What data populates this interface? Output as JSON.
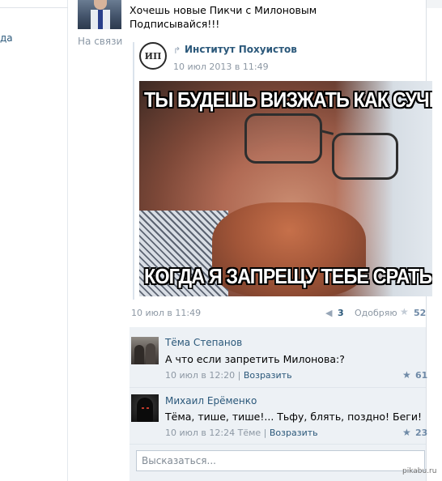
{
  "left": {
    "fragment": "да"
  },
  "post": {
    "author_status": "На связи",
    "text_line1": "Хочешь новые Пикчи с Милоновым",
    "text_line2": "Подписывайся!!!",
    "date": "10 июл в 11:49",
    "shares": "3",
    "like_label": "Одобряю",
    "likes": "52",
    "share_icon": "megaphone-icon",
    "like_icon": "star-icon"
  },
  "repost": {
    "avatar_text": "ИП",
    "icon": "repost-arrow-icon",
    "group_name": "Институт Похуистов",
    "date": "10 июл 2013 в 11:49",
    "meme_top": "ТЫ БУДЕШЬ ВИЗЖАТЬ КАК СУЧКА",
    "meme_bottom": "КОГДА Я ЗАПРЕЩУ ТЕБЕ СРАТЬ"
  },
  "comments": [
    {
      "name": "Тёма Степанов",
      "text": "А что если запретить Милонова:?",
      "date": "10 июл в 12:20",
      "reply_label": "Возразить",
      "likes": "61"
    },
    {
      "name": "Михаил Ерёменко",
      "text": "Тёма, тише, тише!... Тьфу, блять, поздно! Беги!",
      "date": "10 июл в 12:24",
      "reply_to": "Тёме",
      "reply_label": "Возразить",
      "likes": "23"
    }
  ],
  "reply_box": {
    "placeholder": "Высказаться..."
  },
  "watermark": "pikabu.ru",
  "colors": {
    "link": "#2b587a",
    "muted": "#8d98a4",
    "comments_bg": "#edf1f5"
  }
}
